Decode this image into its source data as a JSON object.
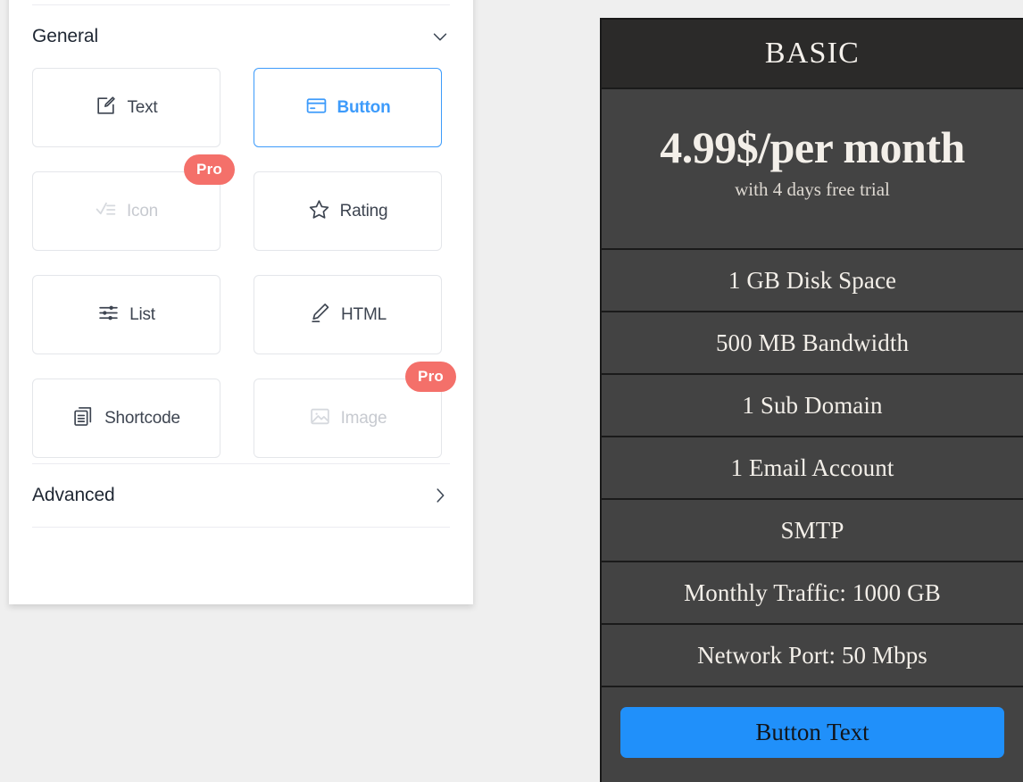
{
  "editor_panel": {
    "sections": [
      {
        "id": "general",
        "title": "General",
        "chevron": "chevron-down-icon",
        "expanded": true
      },
      {
        "id": "advanced",
        "title": "Advanced",
        "chevron": "chevron-right-icon",
        "expanded": false
      }
    ],
    "widgets": [
      {
        "label": "Text",
        "icon": "edit-square-icon",
        "state": "default",
        "badge": null
      },
      {
        "label": "Button",
        "icon": "credit-card-icon",
        "state": "selected",
        "badge": null
      },
      {
        "label": "Icon",
        "icon": "checklist-icon",
        "state": "disabled",
        "badge": "Pro"
      },
      {
        "label": "Rating",
        "icon": "star-icon",
        "state": "default",
        "badge": null
      },
      {
        "label": "List",
        "icon": "sliders-icon",
        "state": "default",
        "badge": null
      },
      {
        "label": "HTML",
        "icon": "pencil-icon",
        "state": "default",
        "badge": null
      },
      {
        "label": "Shortcode",
        "icon": "copy-docs-icon",
        "state": "default",
        "badge": null
      },
      {
        "label": "Image",
        "icon": "image-icon",
        "state": "disabled",
        "badge": "Pro"
      }
    ]
  },
  "pricing_card": {
    "plan_name": "BASIC",
    "price": "4.99$/per month",
    "price_note": "with 4 days free trial",
    "features": [
      "1 GB Disk Space",
      "500 MB Bandwidth",
      "1 Sub Domain",
      "1 Email Account",
      "SMTP",
      "Monthly Traffic: 1000 GB",
      "Network Port: 50 Mbps"
    ],
    "cta_label": "Button Text"
  },
  "colors": {
    "accent_blue": "#3d9bfb",
    "cta_blue": "#2090fa",
    "pro_badge": "#f4706a",
    "card_header_bg": "#2b2a29",
    "card_body_bg": "#434343",
    "page_bg": "#efefef"
  }
}
